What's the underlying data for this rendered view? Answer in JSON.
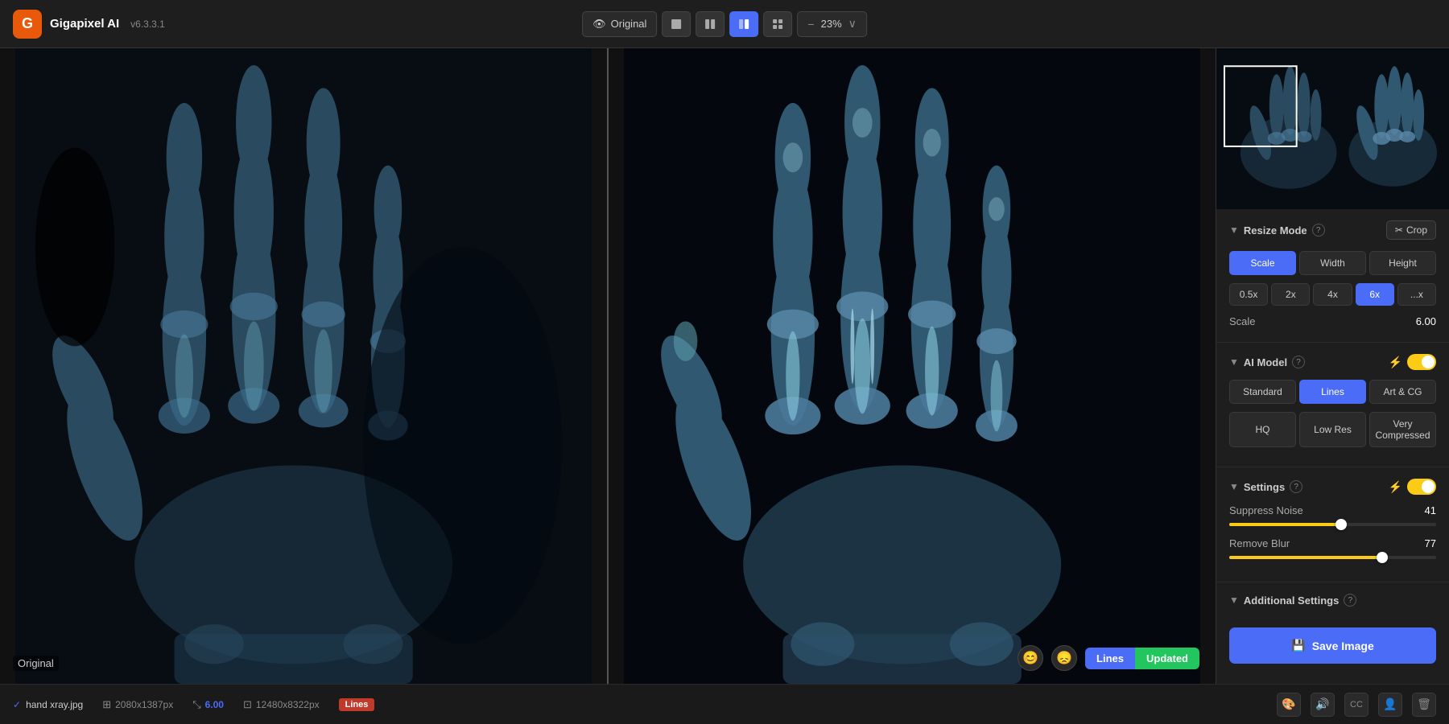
{
  "app": {
    "name": "Gigapixel AI",
    "version": "v6.3.3.1"
  },
  "header": {
    "original_btn": "Original",
    "zoom_value": "23%"
  },
  "canvas": {
    "original_label": "Original",
    "model_badge_left": "Lines",
    "model_badge_right": "Updated"
  },
  "resize_mode": {
    "title": "Resize Mode",
    "crop_btn": "Crop",
    "scale_btn": "Scale",
    "width_btn": "Width",
    "height_btn": "Height",
    "presets": [
      "0.5x",
      "2x",
      "4x",
      "6x",
      "...x"
    ],
    "active_preset": "6x",
    "scale_label": "Scale",
    "scale_value": "6.00"
  },
  "ai_model": {
    "title": "AI Model",
    "standard_btn": "Standard",
    "lines_btn": "Lines",
    "artcg_btn": "Art & CG",
    "hq_btn": "HQ",
    "lowres_btn": "Low Res",
    "verycompressed_btn": "Very Compressed",
    "active_model": "Lines"
  },
  "settings": {
    "title": "Settings",
    "suppress_noise_label": "Suppress Noise",
    "suppress_noise_value": "41",
    "suppress_noise_pct": 54,
    "remove_blur_label": "Remove Blur",
    "remove_blur_value": "77",
    "remove_blur_pct": 74
  },
  "additional_settings": {
    "title": "Additional Settings"
  },
  "save_btn": "Save Image",
  "bottom_bar": {
    "filename": "hand xray.jpg",
    "original_size": "2080x1387px",
    "scale": "6.00",
    "output_size": "12480x8322px",
    "model": "Lines"
  }
}
